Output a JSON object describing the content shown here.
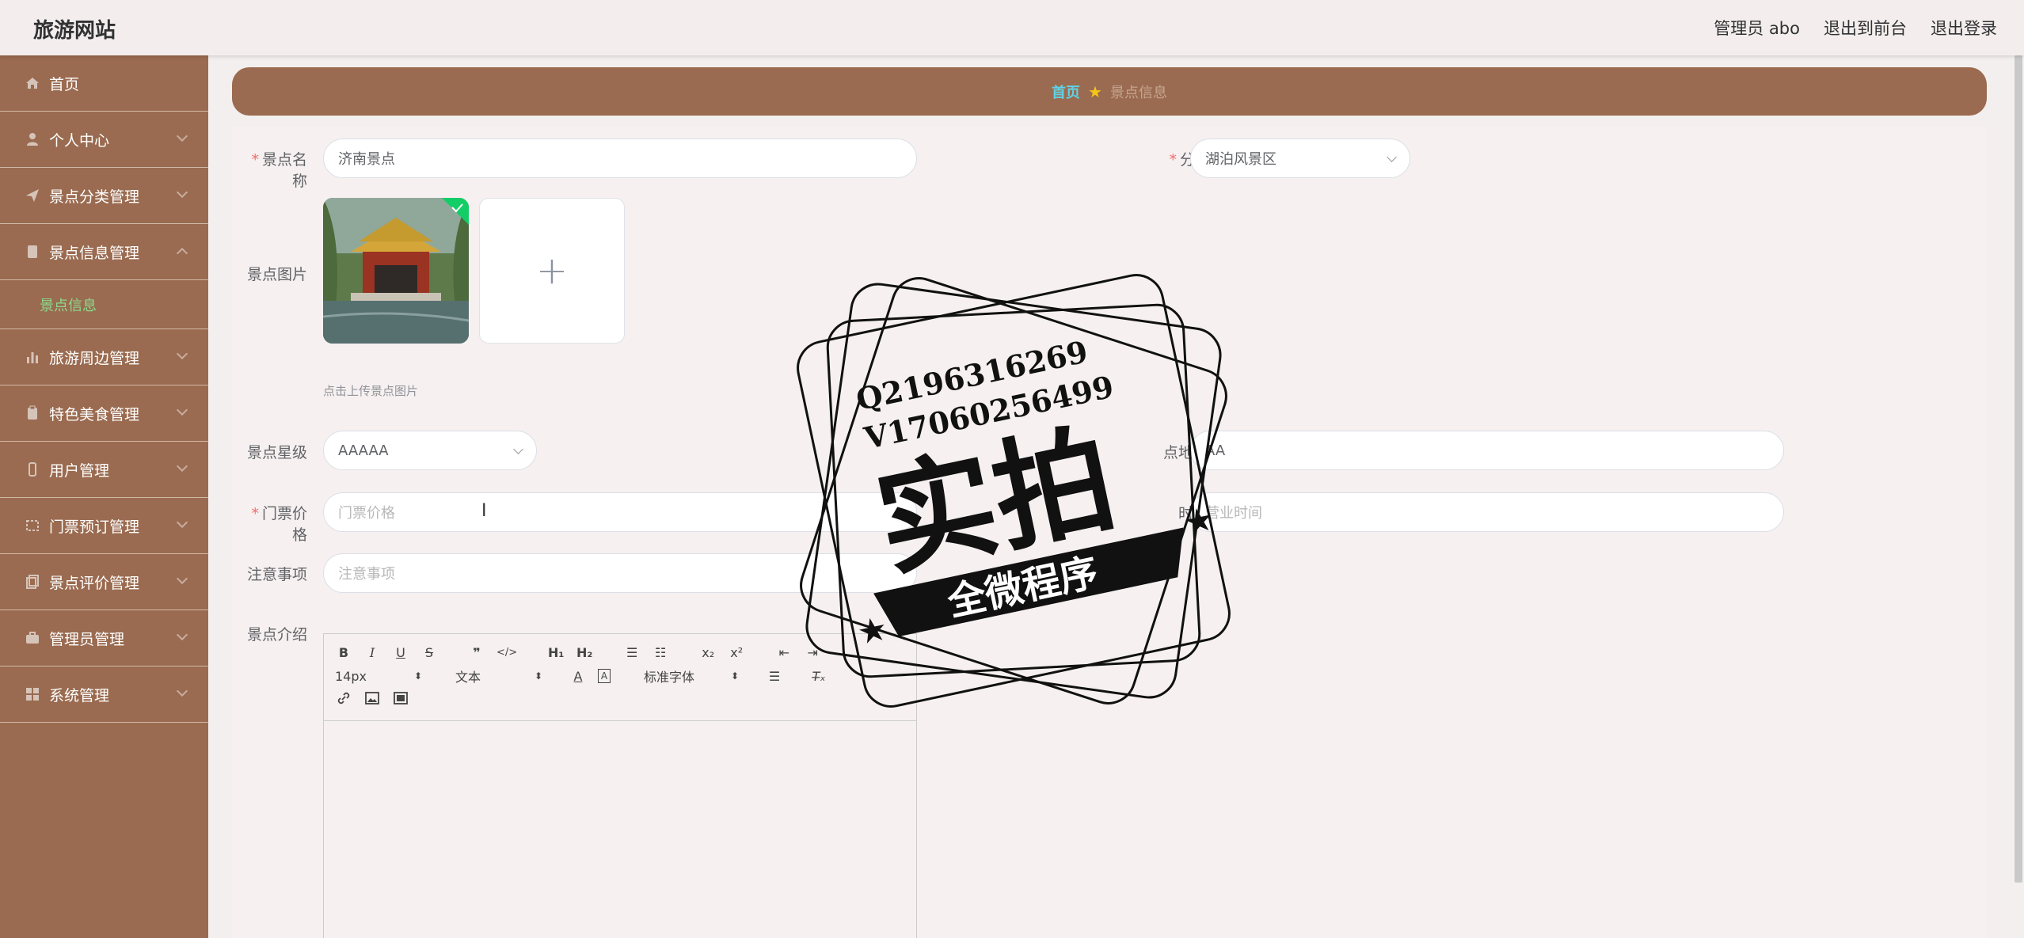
{
  "header": {
    "site_title": "旅游网站",
    "admin_label": "管理员 abo",
    "to_front_label": "退出到前台",
    "logout_label": "退出登录"
  },
  "sidebar": {
    "items": [
      {
        "label": "首页",
        "icon": "home-icon"
      },
      {
        "label": "个人中心",
        "icon": "user-icon"
      },
      {
        "label": "景点分类管理",
        "icon": "send-icon"
      },
      {
        "label": "景点信息管理",
        "icon": "document-icon",
        "expanded": true
      },
      {
        "label": "旅游周边管理",
        "icon": "chart-icon"
      },
      {
        "label": "特色美食管理",
        "icon": "clipboard-icon"
      },
      {
        "label": "用户管理",
        "icon": "phone-icon"
      },
      {
        "label": "门票预订管理",
        "icon": "ticket-icon"
      },
      {
        "label": "景点评价管理",
        "icon": "copy-icon"
      },
      {
        "label": "管理员管理",
        "icon": "briefcase-icon"
      },
      {
        "label": "系统管理",
        "icon": "grid-icon"
      }
    ],
    "sub_item": "景点信息"
  },
  "breadcrumb": {
    "home": "首页",
    "current": "景点信息"
  },
  "form": {
    "name_label": "景点名称",
    "name_value": "济南景点",
    "category_label": "分类",
    "category_value": "湖泊风景区",
    "image_label": "景点图片",
    "upload_hint": "点击上传景点图片",
    "upload_plus": "+",
    "star_label": "景点星级",
    "star_value": "AAAAA",
    "address_label": "点地址",
    "address_value": "AA",
    "price_label": "门票价格",
    "price_placeholder": "门票价格",
    "hours_label": "时间",
    "hours_placeholder": "营业时间",
    "notice_label": "注意事项",
    "notice_placeholder": "注意事项",
    "intro_label": "景点介绍"
  },
  "editor": {
    "font_size": "14px",
    "text_type": "文本",
    "font_family": "标准字体"
  },
  "watermark": {
    "line1": "Q2196316269",
    "line2": "V17060256499",
    "main": "实拍",
    "banner": "全微程序"
  },
  "colors": {
    "sidebar": "#9a6b50",
    "accent_cyan": "#5ed3e6",
    "active_green": "#8cd98c"
  }
}
